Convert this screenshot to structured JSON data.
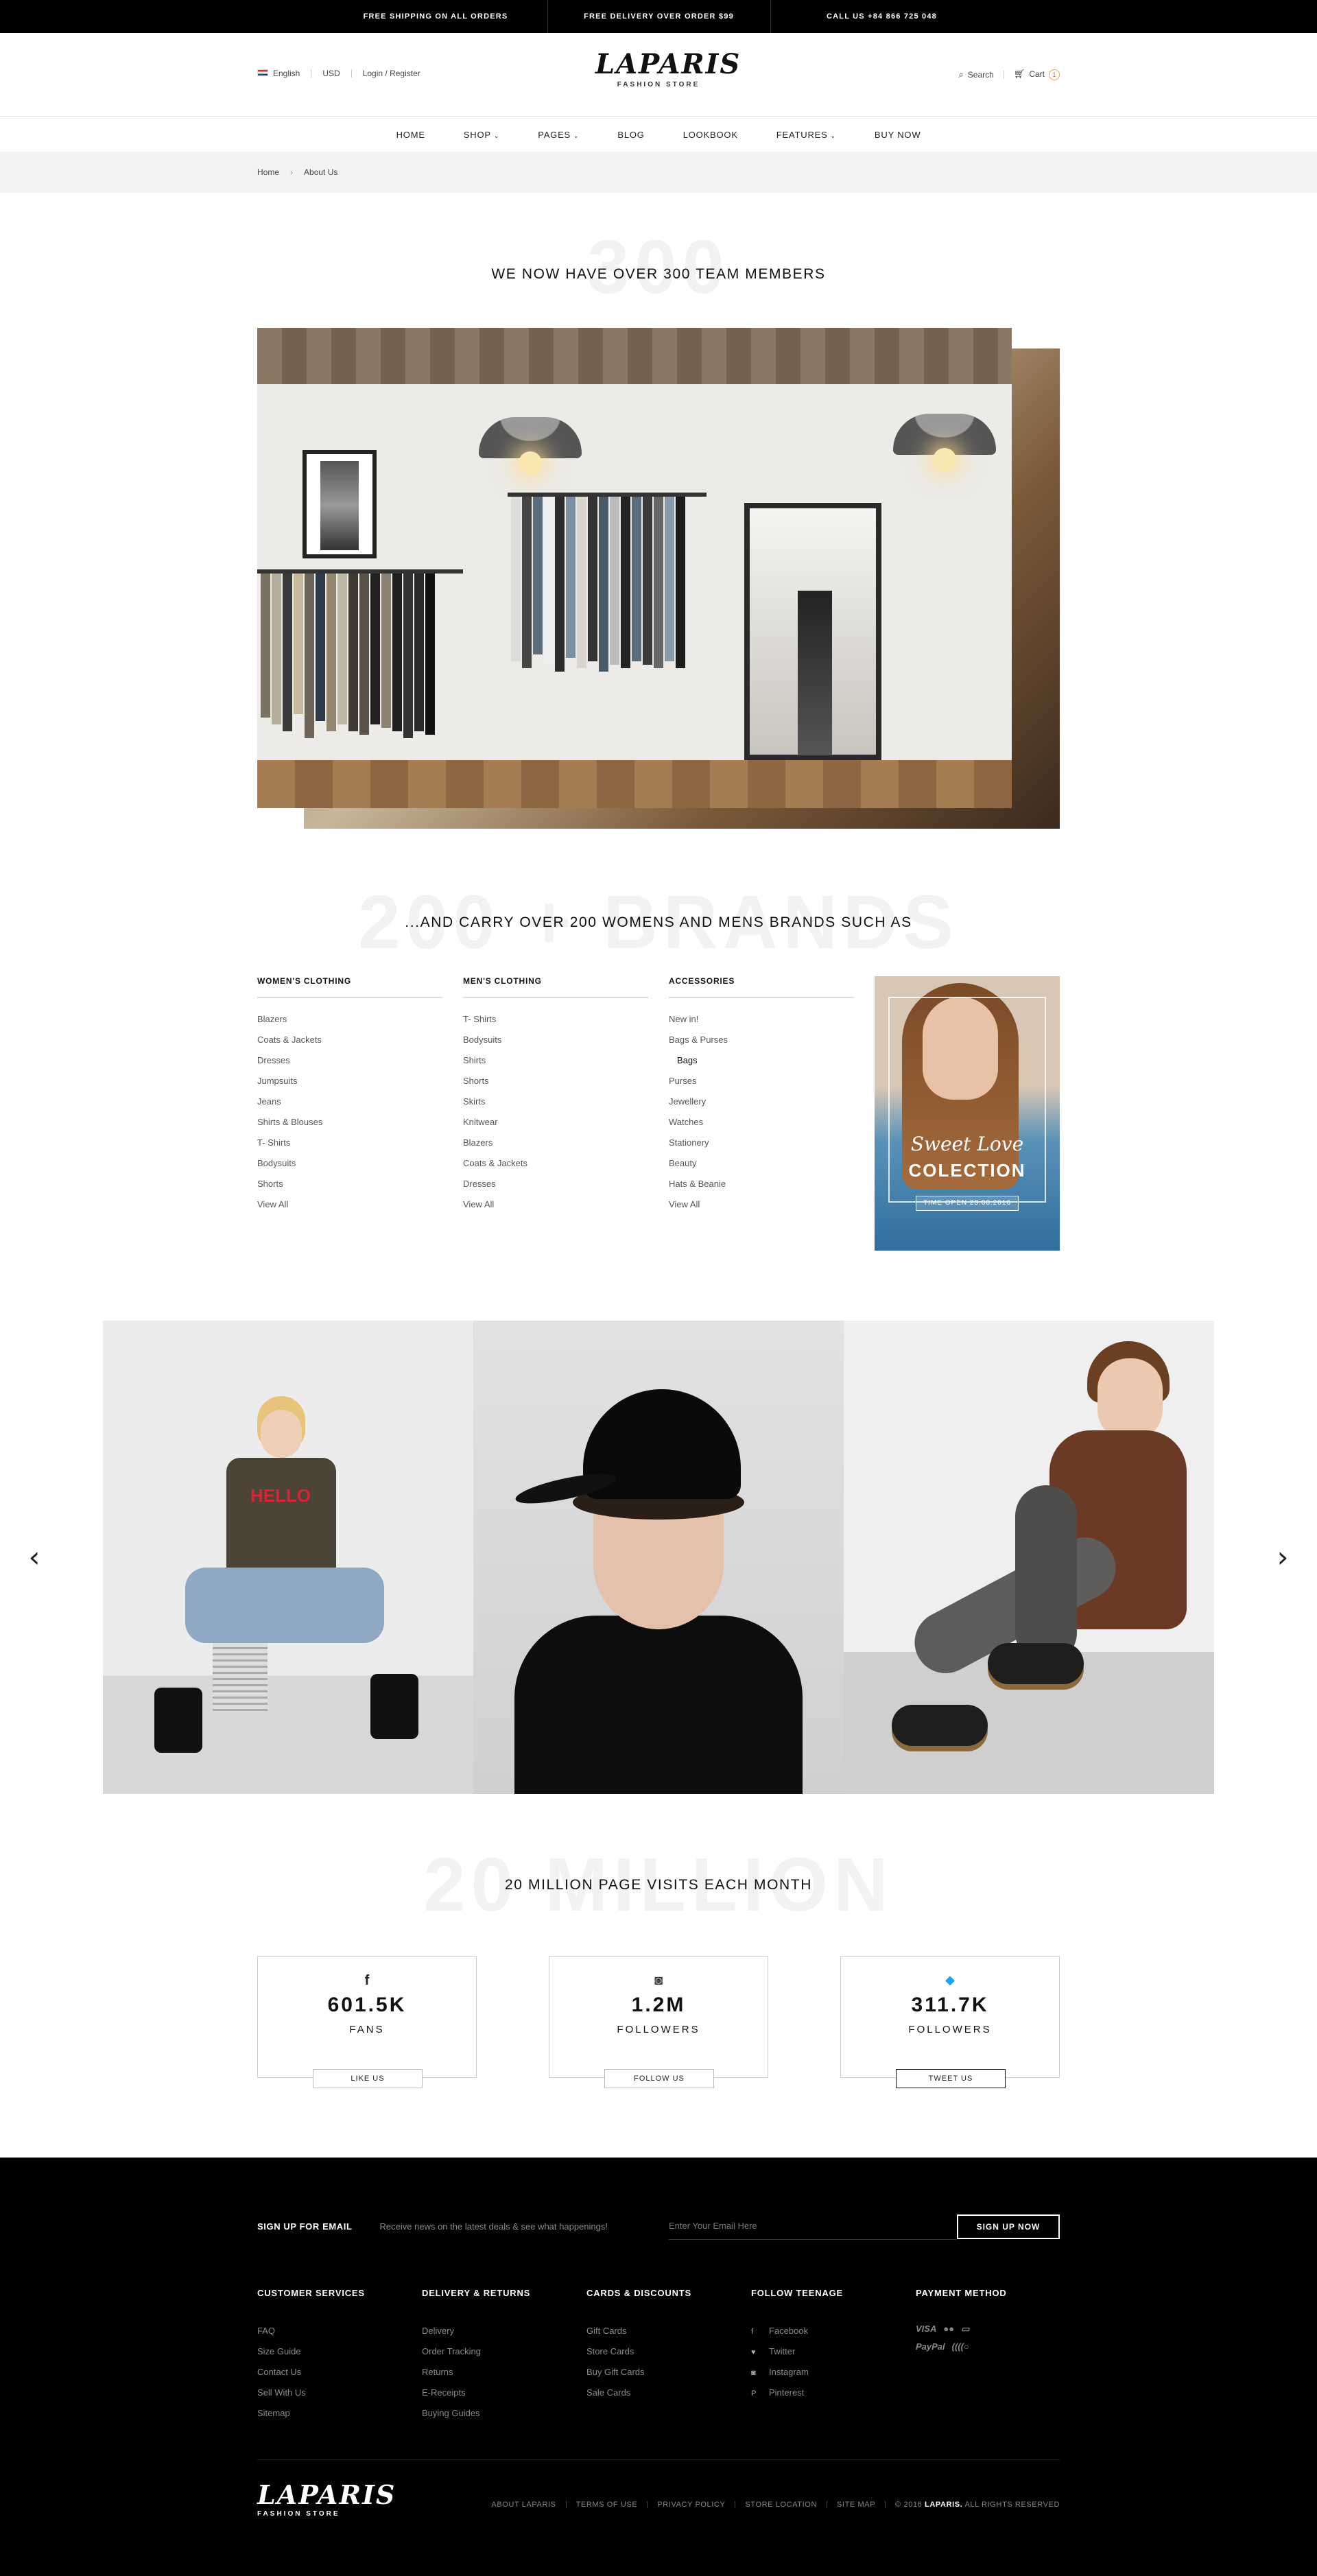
{
  "topbar": {
    "messages": [
      "FREE SHIPPING ON ALL ORDERS",
      "FREE DELIVERY OVER ORDER $99",
      "CALL US +84 866 725 048"
    ]
  },
  "header": {
    "language": "English",
    "currency": "USD",
    "login": "Login / Register",
    "logo_name": "LAPARIS",
    "logo_tagline": "FASHION STORE",
    "search": "Search",
    "cart": "Cart",
    "cart_count": "1"
  },
  "nav": {
    "items": [
      {
        "label": "HOME",
        "dropdown": false
      },
      {
        "label": "SHOP",
        "dropdown": true
      },
      {
        "label": "PAGES",
        "dropdown": true
      },
      {
        "label": "BLOG",
        "dropdown": false
      },
      {
        "label": "LOOKBOOK",
        "dropdown": false
      },
      {
        "label": "FEATURES",
        "dropdown": true
      },
      {
        "label": "BUY NOW",
        "dropdown": false
      }
    ]
  },
  "breadcrumb": {
    "home": "Home",
    "current": "About Us"
  },
  "team": {
    "ghost": "300",
    "title": "WE NOW HAVE OVER 300 TEAM MEMBERS"
  },
  "brands": {
    "ghost": "200 + BRANDS",
    "title": "...AND CARRY OVER 200 WOMENS AND MENS BRANDS SUCH AS",
    "columns": [
      {
        "head": "WOMEN'S CLOTHING",
        "items": [
          "Blazers",
          "Coats & Jackets",
          "Dresses",
          "Jumpsuits",
          "Jeans",
          "Shirts & Blouses",
          "T- Shirts",
          "Bodysuits",
          "Shorts",
          "View All"
        ]
      },
      {
        "head": "MEN'S CLOTHING",
        "items": [
          "T- Shirts",
          "Bodysuits",
          "Shirts",
          "Shorts",
          "Skirts",
          "Knitwear",
          "Blazers",
          "Coats & Jackets",
          "Dresses",
          "View All"
        ]
      },
      {
        "head": "ACCESSORIES",
        "items": [
          "New in!",
          "Bags & Purses",
          "Bags",
          "Purses",
          "Jewellery",
          "Watches",
          "Stationery",
          "Beauty",
          "Hats & Beanie",
          "View All"
        ]
      }
    ],
    "promo": {
      "line1": "Sweet Love",
      "line2": "COLECTION",
      "line3": "TIME OPEN 23.08.2016"
    }
  },
  "visits": {
    "ghost": "20 MILLION",
    "title": "20 MILLION PAGE VISITS EACH MONTH"
  },
  "social": [
    {
      "icon": "facebook-icon",
      "glyph": "f",
      "count": "601.5K",
      "label": "FANS",
      "button": "LIKE US",
      "color": "#222222"
    },
    {
      "icon": "instagram-icon",
      "glyph": "◙",
      "count": "1.2M",
      "label": "FOLLOWERS",
      "button": "FOLLOW US",
      "color": "#444444"
    },
    {
      "icon": "twitter-icon",
      "glyph": "🐦",
      "count": "311.7K",
      "label": "FOLLOWERS",
      "button": "TWEET US",
      "color": "#1da1f2"
    }
  ],
  "footer": {
    "signup_title": "SIGN UP FOR EMAIL",
    "signup_desc": "Receive news on the latest deals & see what happenings!",
    "email_placeholder": "Enter Your Email Here",
    "signup_button": "SIGN UP NOW",
    "columns": [
      {
        "head": "CUSTOMER SERVICES",
        "items": [
          "FAQ",
          "Size Guide",
          "Contact Us",
          "Sell With Us",
          "Sitemap"
        ]
      },
      {
        "head": "DELIVERY & RETURNS",
        "items": [
          "Delivery",
          "Order Tracking",
          "Returns",
          "E-Receipts",
          "Buying Guides"
        ]
      },
      {
        "head": "CARDS & DISCOUNTS",
        "items": [
          "Gift Cards",
          "Store Cards",
          "Buy Gift Cards",
          "Sale Cards"
        ]
      },
      {
        "head": "FOLLOW TEENAGE",
        "items": [
          "Facebook",
          "Twitter",
          "Instagram",
          "Pinterest"
        ]
      }
    ],
    "follow_icons": [
      "f",
      "♥",
      "◙",
      "P"
    ],
    "payment_head": "PAYMENT METHOD",
    "payment": [
      "VISA",
      "●●",
      "▭",
      "PayPal",
      "((((○"
    ],
    "logo_name": "LAPARIS",
    "logo_tagline": "FASHION STORE",
    "links": [
      "ABOUT LAPARIS",
      "TERMS OF USE",
      "PRIVACY POLICY",
      "STORE LOCATION",
      "SITE MAP"
    ],
    "copyright_prefix": "© 2016",
    "copyright_brand": "LAPARIS.",
    "copyright_suffix": "ALL RIGHTS RESERVED"
  }
}
